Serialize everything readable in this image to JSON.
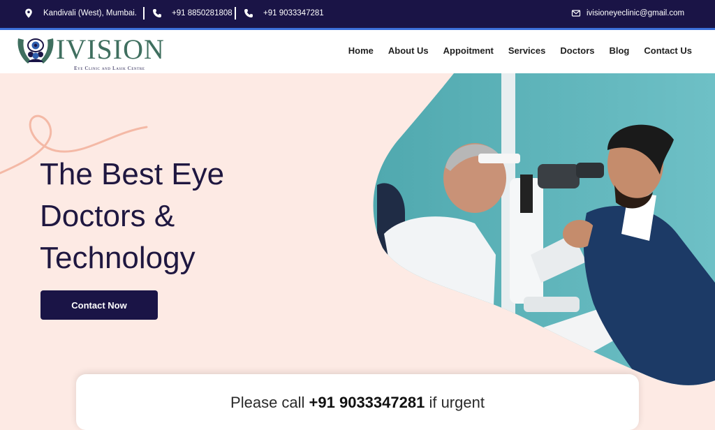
{
  "topbar": {
    "address": "Kandivali (West), Mumbai.",
    "phone1": "+91 8850281808",
    "phone2": "+91 9033347281",
    "email": "ivisioneyeclinic@gmail.com"
  },
  "logo": {
    "wordmark": "IVISION",
    "tagline": "Eye Clinic and Lasik Centre"
  },
  "nav": {
    "items": [
      "Home",
      "About Us",
      "Appoitment",
      "Services",
      "Doctors",
      "Blog",
      "Contact Us"
    ]
  },
  "hero": {
    "title_lines": [
      "The Best Eye",
      "Doctors &",
      "Technology"
    ],
    "cta_label": "Contact Now"
  },
  "notice": {
    "prefix": "Please call ",
    "phone": "+91 9033347281",
    "suffix": " if urgent"
  },
  "colors": {
    "navy": "#1a1446",
    "accent_blue": "#3b6fd8",
    "hero_bg": "#fdeae4",
    "logo_green": "#3f6f5f"
  }
}
